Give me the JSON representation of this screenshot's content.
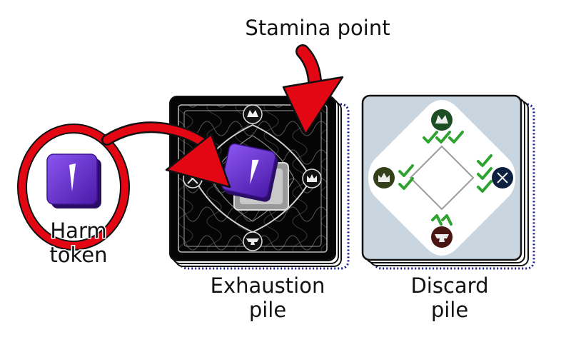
{
  "labels": {
    "stamina_point": "Stamina point",
    "harm_token_line1": "Harm",
    "harm_token_line2": "token",
    "exhaustion_line1": "Exhaustion",
    "exhaustion_line2": "pile",
    "discard_line1": "Discard",
    "discard_line2": "pile"
  },
  "colors": {
    "arrow": "#e30613",
    "token": "#6b2fd0",
    "card_back": "#050505",
    "card_face_bg": "#c9d6e0",
    "check": "#2fa32f",
    "deck_outline": "#1a1a8c"
  },
  "icons": {
    "token_symbol": "claw-mark-icon",
    "discard_top": "wolf-icon",
    "discard_left": "crown-icon",
    "discard_right": "crossed-swords-icon",
    "discard_bottom": "anvil-icon"
  }
}
